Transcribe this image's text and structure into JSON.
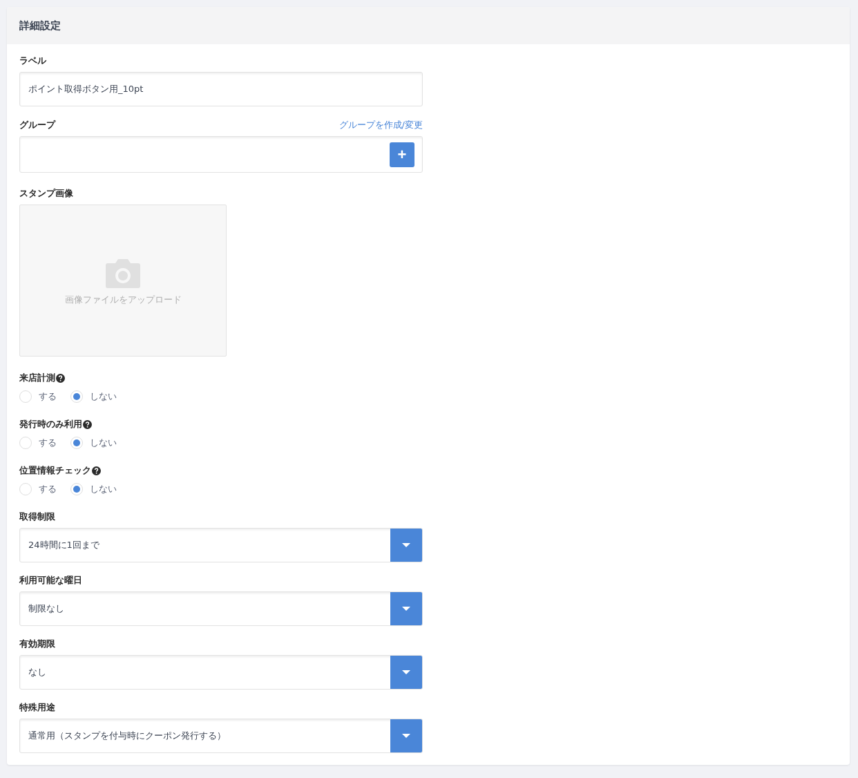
{
  "panel": {
    "title": "詳細設定"
  },
  "fields": [
    {
      "kind": "text",
      "label": "ラベル",
      "value": "ポイント取得ボタン用_10pt"
    },
    {
      "kind": "group",
      "label": "グループ",
      "link": "グループを作成/変更",
      "button": "+"
    },
    {
      "kind": "image",
      "label": "スタンプ画像",
      "hint": "画像ファイルをアップロード"
    },
    {
      "kind": "radio",
      "label": "来店計測",
      "options": [
        {
          "label": "する",
          "selected": false
        },
        {
          "label": "しない",
          "selected": true
        }
      ]
    },
    {
      "kind": "radio",
      "label": "発行時のみ利用",
      "options": [
        {
          "label": "する",
          "selected": false
        },
        {
          "label": "しない",
          "selected": true
        }
      ]
    },
    {
      "kind": "radio",
      "label": "位置情報チェック",
      "options": [
        {
          "label": "する",
          "selected": false
        },
        {
          "label": "しない",
          "selected": true
        }
      ]
    },
    {
      "kind": "select",
      "label": "取得制限",
      "value": "24時間に1回まで"
    },
    {
      "kind": "select",
      "label": "利用可能な曜日",
      "value": "制限なし"
    },
    {
      "kind": "select",
      "label": "有効期限",
      "value": "なし"
    },
    {
      "kind": "select",
      "label": "特殊用途",
      "value": "通常用（スタンプを付与時にクーポン発行する）"
    }
  ]
}
